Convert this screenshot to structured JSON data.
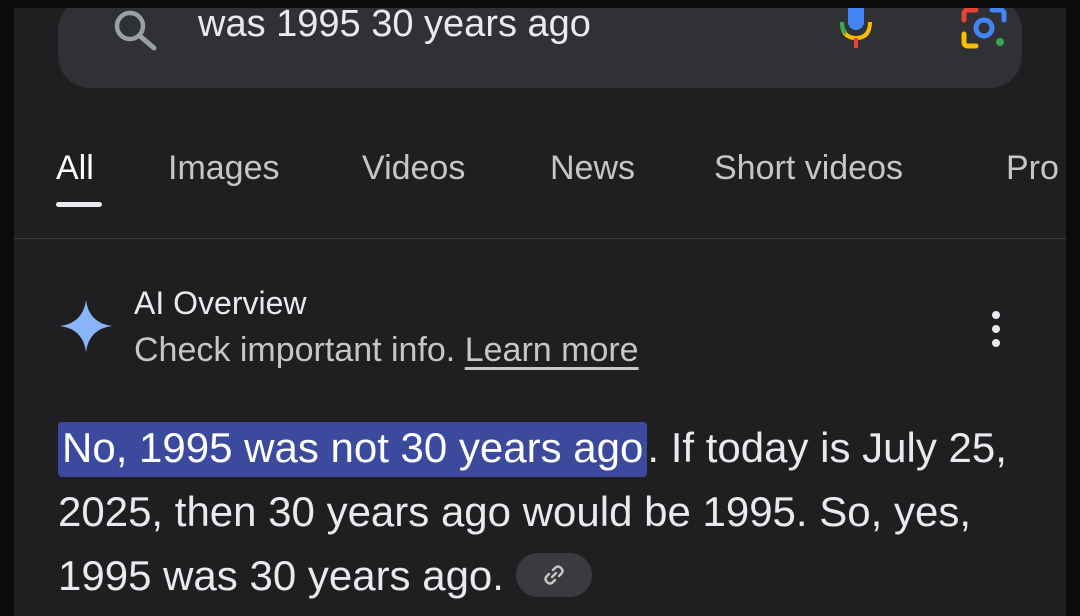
{
  "search": {
    "query": "was 1995 30 years ago"
  },
  "tabs": [
    {
      "label": "All",
      "active": true
    },
    {
      "label": "Images",
      "active": false
    },
    {
      "label": "Videos",
      "active": false
    },
    {
      "label": "News",
      "active": false
    },
    {
      "label": "Short videos",
      "active": false
    },
    {
      "label": "Pro",
      "active": false
    }
  ],
  "ai_overview": {
    "title": "AI Overview",
    "subtitle_prefix": "Check important info.",
    "learn_more": "Learn more",
    "answer_highlight": "No, 1995 was not 30 years ago",
    "answer_rest": ". If today is July 25, 2025, then 30 years ago would be 1995. So, yes, 1995 was 30 years ago."
  },
  "colors": {
    "background": "#1f1f21",
    "searchbar": "#303134",
    "highlight": "#3b4a9c",
    "sparkle": "#8ab4f8"
  },
  "icons": [
    "search-icon",
    "mic-icon",
    "lens-icon",
    "ai-sparkle-icon",
    "more-vert-icon",
    "link-icon"
  ]
}
